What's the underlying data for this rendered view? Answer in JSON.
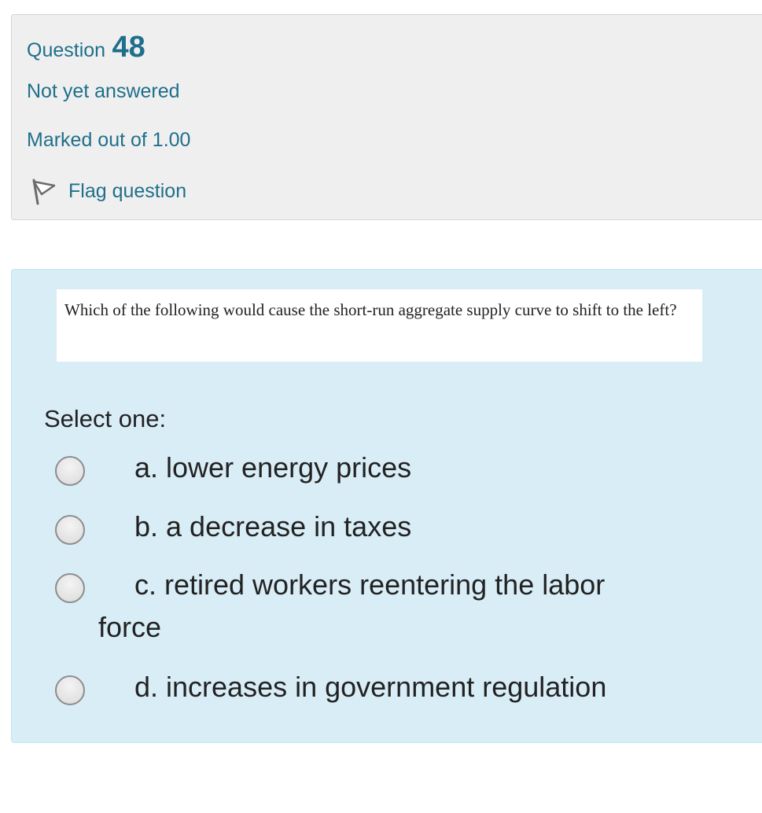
{
  "info": {
    "question_word": "Question",
    "question_number": "48",
    "state": "Not yet answered",
    "grade": "Marked out of 1.00",
    "flag_label": "Flag question",
    "flag_icon": "flag-icon"
  },
  "question": {
    "text": "Which of the following would cause the short-run aggregate supply curve to shift to the left?",
    "prompt": "Select one:",
    "options": [
      {
        "label": "a. lower energy prices"
      },
      {
        "label": "b. a decrease in taxes"
      },
      {
        "label": "c. retired workers reentering the labor force"
      },
      {
        "label": "d. increases in government regulation"
      }
    ]
  },
  "colors": {
    "link": "#1f6f8b",
    "info_bg": "#efefef",
    "content_bg": "#d9edf7"
  }
}
